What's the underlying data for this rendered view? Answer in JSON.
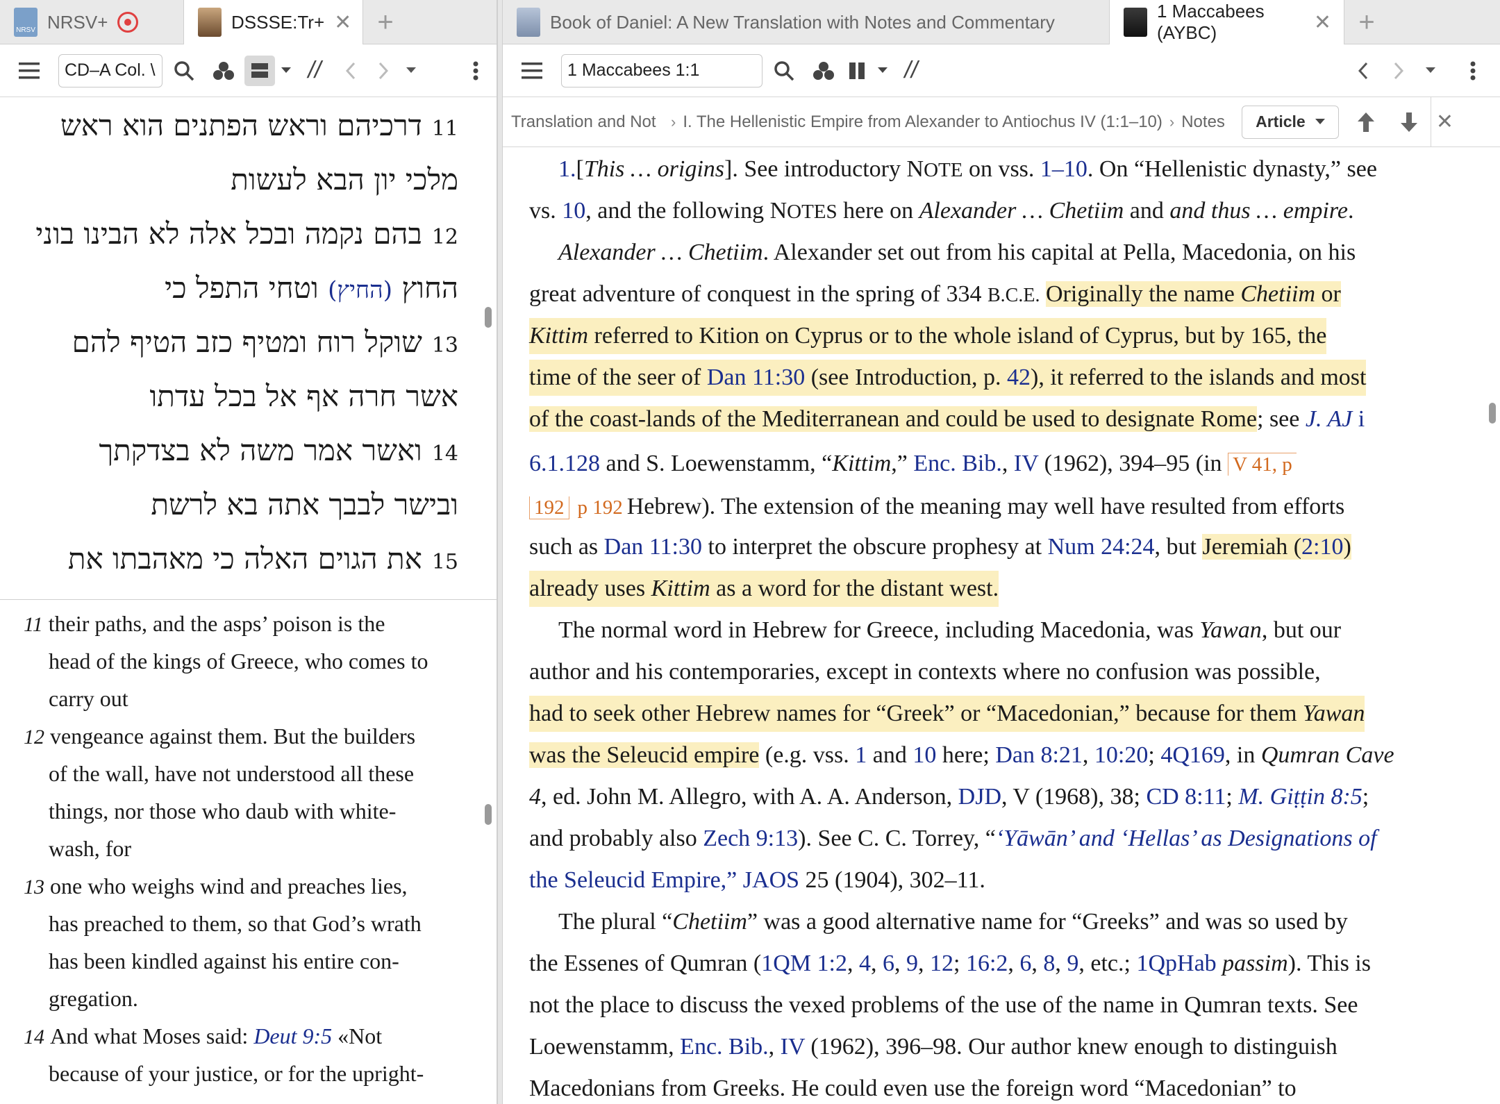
{
  "left": {
    "tabs": [
      {
        "label": "NRSV+",
        "thumb": "NRSV"
      },
      {
        "label": "DSSSE:Tr+"
      }
    ],
    "toolbar": {
      "reference": "CD–A Col. \\"
    },
    "hebrew": [
      {
        "num": "11",
        "text": "דרכיהם וראש הפתנים הוא ראש"
      },
      {
        "num": "",
        "text": "מלכי יון הבא לעשות"
      },
      {
        "num": "12",
        "text": "בהם נקמה ובכל אלה לא הבינו בוני"
      },
      {
        "num": "",
        "text": "החוץ",
        "paren": "(החיץ)",
        "rest": "וטחי התפל כי"
      },
      {
        "num": "13",
        "text": "שוקל רוח ומטיף כזב הטיף להם"
      },
      {
        "num": "",
        "text": "אשר חרה אף אל בכל עדתו"
      },
      {
        "num": "14",
        "text": "ואשר אמר משה לא בצדקתך"
      },
      {
        "num": "",
        "text": "ובישר לבבך אתה בא לרשת"
      },
      {
        "num": "15",
        "text": "את הגוים האלה כי מאהבתו את"
      }
    ],
    "english": [
      {
        "num": "11",
        "text": "their paths, and the asps’ poison is the"
      },
      {
        "num": "",
        "text": "head of the kings of Greece, who comes to"
      },
      {
        "num": "",
        "text": "carry out"
      },
      {
        "num": "12",
        "text": "vengeance against them. But the builders"
      },
      {
        "num": "",
        "text": "of the wall, have not understood all these"
      },
      {
        "num": "",
        "text": "things, nor those who daub with white-"
      },
      {
        "num": "",
        "text": "wash, for"
      },
      {
        "num": "13",
        "text": "one who weighs wind and preaches lies,"
      },
      {
        "num": "",
        "text": "has preached to them, so that God’s wrath"
      },
      {
        "num": "",
        "text": "has been kindled against his entire con-"
      },
      {
        "num": "",
        "text": "gregation."
      },
      {
        "num": "14",
        "text": "And what Moses said:",
        "link": "Deut 9:5",
        "after": "«Not"
      },
      {
        "num": "",
        "text": "because of your justice, or for the upright-"
      }
    ]
  },
  "right": {
    "tabs": [
      {
        "label": "Book of Daniel: A New Translation with Notes and Commentary"
      },
      {
        "label": "1 Maccabees (AYBC)"
      }
    ],
    "toolbar": {
      "reference": "1 Maccabees 1:1"
    },
    "breadcrumb": {
      "items": [
        "Translation and Not",
        "I. The Hellenistic Empire from Alexander to Antiochus IV (1:1–10)",
        "Notes"
      ],
      "article_button": "Article"
    },
    "commentary": {
      "l1": {
        "n": "1.",
        "a": "[",
        "b": "This … origins",
        "c": "]. See introductory N",
        "d": "OTE",
        "e": " on vss. ",
        "f": "1–10",
        "g": ". On “Hellenistic dynasty,” see"
      },
      "l2": {
        "a": "vs. ",
        "b": "10",
        "c": ", and the following N",
        "d": "OTES",
        "e": " here on ",
        "f": "Alexander … Chetiim",
        "g": " and ",
        "h": "and thus … empire",
        "i": "."
      },
      "l3": {
        "a": "Alexander … Chetiim",
        "b": ". Alexander set out from his capital at Pella, Macedonia, on his"
      },
      "l4": {
        "a": "great adventure of conquest in the spring of 334 ",
        "b": "B.C.E.",
        "c": " ",
        "d": "Originally the name ",
        "e": "Chetiim",
        "f": " or"
      },
      "l5": {
        "a": "Kittim",
        "b": " referred to Kition on Cyprus or to the whole island of Cyprus, but by 165, the"
      },
      "l6": {
        "a": "time of the seer of ",
        "b": "Dan 11:30",
        "c": " (see Introduction, p. ",
        "d": "42",
        "e": "), it referred to the islands and most"
      },
      "l7": {
        "a": "of the coast-lands of the Mediterranean and could be used to designate Rome",
        "b": "; see ",
        "c": "J. AJ",
        "d": " i"
      },
      "l8": {
        "a": "6.1.128",
        "b": " and S. Loewenstamm, “",
        "c": "Kittim",
        "d": ",” ",
        "e": "Enc. Bib.",
        "f": ", ",
        "g": "IV",
        "h": " (1962), 394–95 (in ",
        "i": "V 41, p"
      },
      "l9": {
        "a": "192",
        "b": "p 192",
        "c": "Hebrew). The extension of the meaning may well have resulted from efforts"
      },
      "l10": {
        "a": "such as ",
        "b": "Dan 11:30",
        "c": " to interpret the obscure prophesy at ",
        "d": "Num 24:24",
        "e": ", but ",
        "f": "Jeremiah (",
        "g": "2:10",
        "h": ")"
      },
      "l11": {
        "a": "already uses ",
        "b": "Kittim",
        "c": " as a word for the distant west."
      },
      "l12": {
        "a": "The normal word in Hebrew for Greece, including Macedonia, was ",
        "b": "Yawan",
        "c": ", but our"
      },
      "l13": {
        "a": "author and his contemporaries, except in contexts where no confusion was possible,"
      },
      "l14": {
        "a": "had to seek other Hebrew names for “Greek” or “Macedonian,” because for them ",
        "b": "Yawan"
      },
      "l15": {
        "a": "was the Seleucid empire",
        "b": " (e.g. vss. ",
        "c": "1",
        "d": " and ",
        "e": "10",
        "f": " here; ",
        "g": "Dan 8:21",
        "h": ", ",
        "i": "10:20",
        "j": "; ",
        "k": "4Q169",
        "l": ", in ",
        "m": "Qumran Cave"
      },
      "l16": {
        "a": "4",
        "b": ", ed. John M. Allegro, with A. A. Anderson, ",
        "c": "DJD",
        "d": ", V (1968), 38; ",
        "e": "CD 8:11",
        "f": "; ",
        "g": "M. Giṭṭin 8:5",
        "h": ";"
      },
      "l17": {
        "a": "and probably also ",
        "b": "Zech 9:13",
        "c": "). See C. C. Torrey, “",
        "d": "‘Yāwān’ and ‘Hellas’ as Designations of"
      },
      "l18": {
        "a": "the Seleucid Empire,”",
        "b": " ",
        "c": "JAOS",
        "d": " 25 (1904), 302–11."
      },
      "l19": {
        "a": "The plural “",
        "b": "Chetiim",
        "c": "” was a good alternative name for “Greeks” and was so used by"
      },
      "l20": {
        "a": "the Essenes of Qumran (",
        "b": "1QM 1:2",
        "c": ", ",
        "d": "4",
        "e": ", ",
        "f": "6",
        "g": ", ",
        "h": "9",
        "i": ", ",
        "j": "12",
        "k": "; ",
        "l": "16:2",
        "m": ", ",
        "n": "6",
        "o": ", ",
        "p": "8",
        "q": ", ",
        "r": "9",
        "s": ", etc.; ",
        "t": "1QpHab",
        "u": " ",
        "v": "passim",
        "w": "). This is"
      },
      "l21": {
        "a": "not the place to discuss the vexed problems of the use of the name in Qumran texts. See"
      },
      "l22": {
        "a": "Loewenstamm, ",
        "b": "Enc. Bib.",
        "c": ", ",
        "d": "IV",
        "e": " (1962), 396–98. Our author knew enough to distinguish"
      },
      "l23": {
        "a": "Macedonians from Greeks. He could even use the foreign word “Macedonian” to"
      }
    }
  },
  "colors": {
    "highlight": "#fbefc0",
    "link": "#1a2e8f",
    "page_marker": "#d2691e",
    "tabbar": "#e9e9e9"
  }
}
